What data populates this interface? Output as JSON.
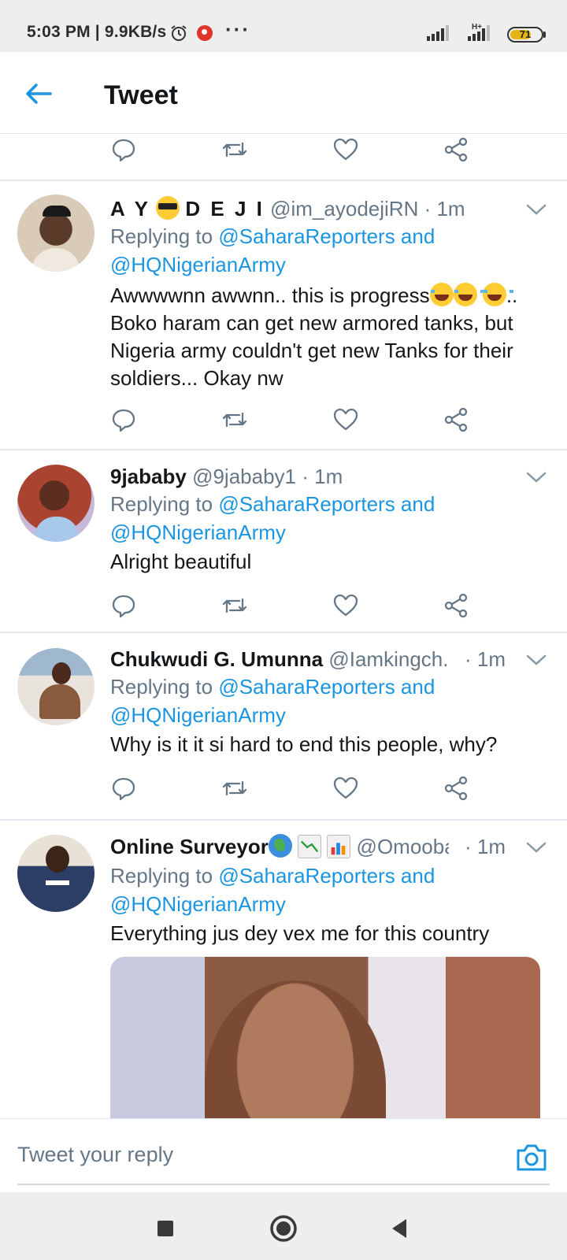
{
  "status_bar": {
    "time_and_speed": "5:03 PM | 9.9KB/s",
    "more": "···",
    "network_label": "H+",
    "battery": "71",
    "battery_level": 0.71
  },
  "header": {
    "title": "Tweet"
  },
  "colors": {
    "accent": "#1b95e0",
    "secondary_text": "#657786",
    "primary_text": "#14171a",
    "divider": "#e1e8ed"
  },
  "tweets": [
    {
      "name_prefix": "A Y",
      "name_suffix": "D E J I",
      "name_emoji": "smiling-face-with-sunglasses",
      "handle": "@im_ayodejiRN",
      "time": "· 1m",
      "replying_prefix": "Replying to",
      "replying_mentions": "@SaharaReporters and @HQNigerianArmy",
      "text_1": "Awwwwnn  awwnn..     this is progress",
      "text_2": "..  Boko haram can get new armored tanks, but Nigeria army couldn't get new Tanks for their soldiers...  Okay nw",
      "emoji": "face-with-tears-of-joy"
    },
    {
      "name": "9jababy",
      "handle": "@9jababy1",
      "time": "· 1m",
      "replying_prefix": "Replying to",
      "replying_mentions": "@SaharaReporters and @HQNigerianArmy",
      "text": "Alright beautiful"
    },
    {
      "name": "Chukwudi G. Umunna",
      "handle": "@Iamkingch...",
      "time": "· 1m",
      "replying_prefix": "Replying to",
      "replying_mentions": "@SaharaReporters and @HQNigerianArmy",
      "text": "Why is it it si hard to end this people, why?"
    },
    {
      "name": "Online Surveyor",
      "name_emojis": [
        "globe-icon",
        "chart-decreasing-icon",
        "bar-chart-icon"
      ],
      "handle": "@Omooba...",
      "time": "· 1m",
      "replying_prefix": "Replying to",
      "replying_mentions": "@SaharaReporters and @HQNigerianArmy",
      "text": "Everything jus dey vex me for this country",
      "has_media": true
    }
  ],
  "actions": [
    "reply-icon",
    "retweet-icon",
    "like-icon",
    "share-icon"
  ],
  "reply_bar": {
    "placeholder": "Tweet your reply"
  },
  "nav_bar": [
    "recents-button",
    "home-button",
    "back-button"
  ]
}
